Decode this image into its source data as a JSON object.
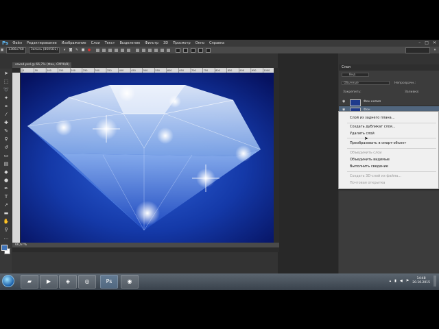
{
  "app": {
    "logo": "Ps",
    "menu": [
      "Файл",
      "Редактирование",
      "Изображение",
      "Слои",
      "Текст",
      "Выделение",
      "Фильтр",
      "3D",
      "Просмотр",
      "Окно",
      "Справка"
    ],
    "window_controls": [
      "–",
      "□",
      "✕"
    ]
  },
  "options_bar": {
    "size_value": "1366x768",
    "action_field": "Запись (8605D2)"
  },
  "document": {
    "tab_title": "saved.psd @ 66,7% (Фон, CMYK/8)",
    "zoom_status": "66,67%",
    "ruler_ticks": [
      "0",
      "50",
      "100",
      "150",
      "200",
      "250",
      "300",
      "350",
      "400",
      "450",
      "500",
      "550",
      "600",
      "650",
      "700",
      "750",
      "800",
      "850",
      "900",
      "950",
      "1000"
    ]
  },
  "layers_panel": {
    "title": "Слои",
    "kind_filter": "Вид",
    "blend_mode": "Обычные",
    "opacity_label": "Непрозрачн.:",
    "lock_label": "Закрепить:",
    "fill_label": "Заливка:",
    "layers": [
      {
        "name": "Фон копия",
        "selected": false
      },
      {
        "name": "Фон",
        "selected": true
      }
    ]
  },
  "context_menu": {
    "items": [
      {
        "label": "Слой из заднего плана...",
        "disabled": false
      },
      {
        "label": "Создать дубликат слоя...",
        "disabled": false
      },
      {
        "label": "Удалить слой",
        "disabled": false
      },
      {
        "label": "Преобразовать в смарт-объект",
        "disabled": false
      },
      {
        "label": "Объединить слои",
        "disabled": true
      },
      {
        "label": "Объединить видимые",
        "disabled": false
      },
      {
        "label": "Выполнить сведение",
        "disabled": false
      },
      {
        "label": "Создать 3D-слой из файла...",
        "disabled": true
      },
      {
        "label": "Почтовая открытка",
        "disabled": true
      }
    ]
  },
  "taskbar": {
    "buttons": [
      "folder-icon",
      "media-player-icon",
      "media-center-icon",
      "chrome-icon",
      "photoshop-icon",
      "recorder-icon"
    ],
    "time": "14:48",
    "date": "20.10.2015"
  },
  "colors": {
    "ps_blue": "#5db6f0",
    "foreground": "#3f73b8",
    "background": "#ffffff",
    "selected_layer": "#51667e"
  }
}
